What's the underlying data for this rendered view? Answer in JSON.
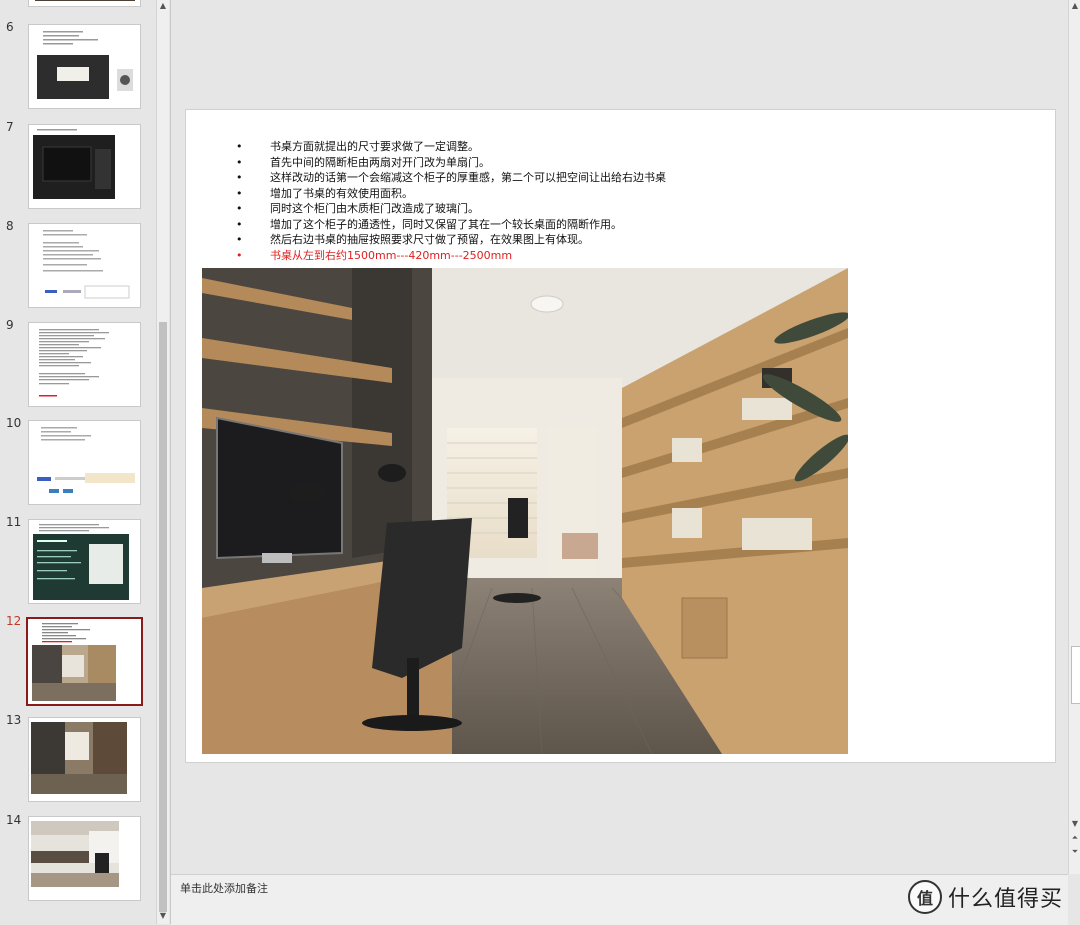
{
  "thumbnails": [
    {
      "number": "6"
    },
    {
      "number": "7"
    },
    {
      "number": "8"
    },
    {
      "number": "9"
    },
    {
      "number": "10"
    },
    {
      "number": "11"
    },
    {
      "number": "12",
      "active": true
    },
    {
      "number": "13"
    },
    {
      "number": "14"
    }
  ],
  "slide": {
    "bullets": [
      "书桌方面就提出的尺寸要求做了一定调整。",
      "首先中间的隔断柜由两扇对开门改为单扇门。",
      "这样改动的话第一个会缩减这个柜子的厚重感，第二个可以把空间让出给右边书桌",
      "增加了书桌的有效使用面积。",
      "同时这个柜门由木质柜门改造成了玻璃门。",
      "增加了这个柜子的通透性，同时又保留了其在一个较长桌面的隔断作用。",
      "然后右边书桌的抽屉按照要求尺寸做了预留，在效果图上有体现。",
      "书桌从左到右约1500mm---420mm---2500mm"
    ],
    "highlight_color": "#e02020"
  },
  "notes": {
    "placeholder": "单击此处添加备注"
  },
  "watermark": {
    "icon": "值",
    "text": "什么值得买"
  },
  "colors": {
    "active_border": "#8b1a1a",
    "active_number": "#c0392b"
  }
}
